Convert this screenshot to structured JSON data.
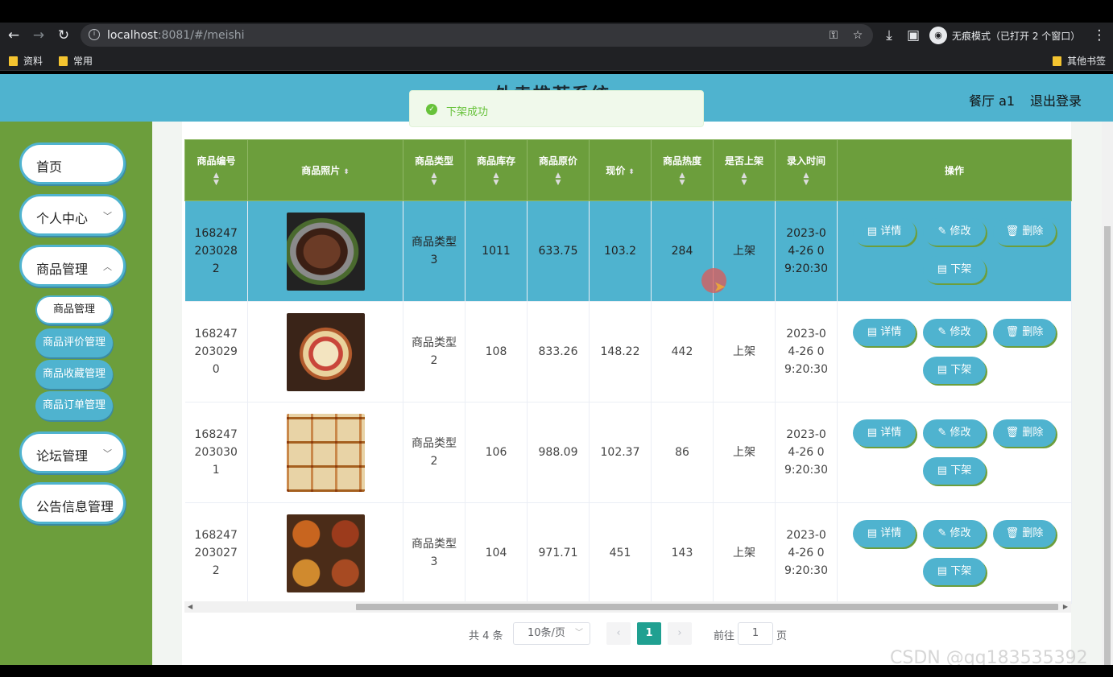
{
  "browser": {
    "url_host": "localhost",
    "url_rest": ":8081/#/meishi",
    "incognito": "无痕模式（已打开 2 个窗口）",
    "bookmarks": [
      "资料",
      "常用"
    ],
    "other_bookmarks": "其他书签"
  },
  "header": {
    "title": "外卖推荐系统",
    "user": "餐厅 a1",
    "logout": "退出登录"
  },
  "toast": {
    "message": "下架成功"
  },
  "sidebar": {
    "menus": [
      {
        "label": "首页"
      },
      {
        "label": "个人中心"
      },
      {
        "label": "商品管理"
      },
      {
        "label": "论坛管理"
      },
      {
        "label": "公告信息管理"
      }
    ],
    "submenus": [
      {
        "label": "商品管理",
        "active": true
      },
      {
        "label": "商品评价管理"
      },
      {
        "label": "商品收藏管理"
      },
      {
        "label": "商品订单管理"
      }
    ]
  },
  "table": {
    "columns": [
      "商品编号",
      "商品照片",
      "商品类型",
      "商品库存",
      "商品原价",
      "现价",
      "商品热度",
      "是否上架",
      "录入时间",
      "操作"
    ],
    "rows": [
      {
        "id": "1682472030282",
        "type": "商品类型3",
        "stock": "1011",
        "orig": "633.75",
        "price": "103.2",
        "heat": "284",
        "status": "上架",
        "time": "2023-04-26 09:20:30",
        "highlight": true
      },
      {
        "id": "1682472030290",
        "type": "商品类型2",
        "stock": "108",
        "orig": "833.26",
        "price": "148.22",
        "heat": "442",
        "status": "上架",
        "time": "2023-04-26 09:20:30"
      },
      {
        "id": "1682472030301",
        "type": "商品类型2",
        "stock": "106",
        "orig": "988.09",
        "price": "102.37",
        "heat": "86",
        "status": "上架",
        "time": "2023-04-26 09:20:30"
      },
      {
        "id": "1682472030272",
        "type": "商品类型3",
        "stock": "104",
        "orig": "971.71",
        "price": "451",
        "heat": "143",
        "status": "上架",
        "time": "2023-04-26 09:20:30"
      }
    ],
    "actions": {
      "detail": "详情",
      "edit": "修改",
      "delete": "删除",
      "offshelf": "下架"
    }
  },
  "pagination": {
    "total": "共 4 条",
    "page_size": "10条/页",
    "current_page": "1",
    "goto_prefix": "前往",
    "goto_value": "1",
    "goto_suffix": "页"
  },
  "watermark": "CSDN @qq183535392"
}
